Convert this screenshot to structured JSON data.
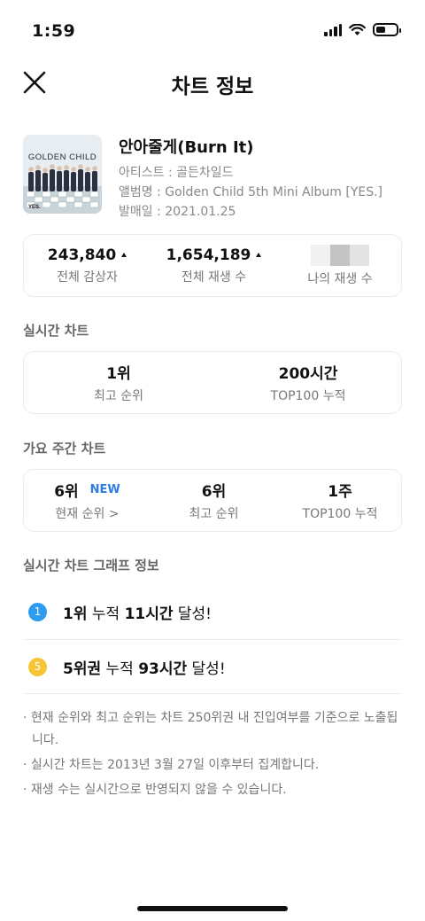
{
  "status_bar": {
    "time": "1:59"
  },
  "header": {
    "title": "차트 정보"
  },
  "song": {
    "cover_text": "GOLDEN CHILD",
    "cover_tag": "YES.",
    "title": "안아줄게(Burn It)",
    "artist": "아티스트 : 골든차일드",
    "album": "앨범명 : Golden Child 5th Mini Album   [YES.]",
    "release": "발매일 : 2021.01.25"
  },
  "summary": {
    "listeners_value": "243,840",
    "listeners_label": "전체 감상자",
    "plays_value": "1,654,189",
    "plays_label": "전체 재생 수",
    "my_plays_label": "나의 재생 수"
  },
  "realtime": {
    "section_title": "실시간 차트",
    "best_rank_value": "1위",
    "best_rank_label": "최고 순위",
    "top100_value": "200시간",
    "top100_label": "TOP100 누적"
  },
  "weekly": {
    "section_title": "가요 주간 차트",
    "current_value": "6위",
    "current_badge": "NEW",
    "current_label": "현재 순위 >",
    "best_value": "6위",
    "best_label": "최고 순위",
    "top100_value": "1주",
    "top100_label": "TOP100 누적"
  },
  "graph": {
    "section_title": "실시간 차트 그래프 정보",
    "items": [
      {
        "badge": "1",
        "color": "#2d9cf0",
        "rank": "1위",
        "mid": " 누적 ",
        "hours": "11시간",
        "suffix": " 달성!"
      },
      {
        "badge": "5",
        "color": "#f5c535",
        "rank": "5위권",
        "mid": " 누적 ",
        "hours": "93시간",
        "suffix": " 달성!"
      }
    ]
  },
  "notes": [
    "· 현재 순위와 최고 순위는 차트 250위권 내 진입여부를 기준으로 노출됩니다.",
    "· 실시간 차트는 2013년 3월 27일 이후부터 집계합니다.",
    "· 재생 수는 실시간으로 반영되지 않을 수 있습니다."
  ]
}
